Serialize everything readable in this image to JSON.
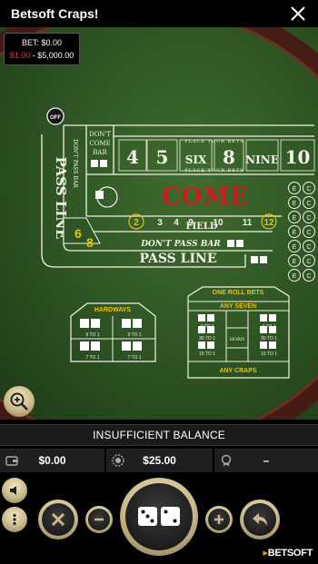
{
  "app": {
    "title": "Betsoft Craps!"
  },
  "bet_box": {
    "bet_label": "BET: $0.00",
    "min": "$1.00",
    "range_rest": " - $5,000.00"
  },
  "table": {
    "off_puck": "OFF",
    "dont_come_bar": [
      "DON'T",
      "COME",
      "BAR"
    ],
    "place_your_bets": "PLACE YOUR BETS",
    "place_numbers": [
      "4",
      "5",
      "SIX",
      "8",
      "NINE",
      "10"
    ],
    "come": "COME",
    "field_numbers": [
      "2",
      "3",
      "4",
      "9",
      "10",
      "11",
      "12"
    ],
    "field": "FIELD",
    "dont_pass_bar": "DON'T PASS BAR",
    "pass_line": "PASS LINE",
    "dont_pass_bar_vertical": "DON'T PASS BAR",
    "big_six": "6",
    "big_eight": "8",
    "hardways": "HARDWAYS",
    "hardways_odds": [
      "9 TO 1",
      "9 TO 1",
      "7 TO 1",
      "7 TO 1"
    ],
    "one_roll_bets": "ONE ROLL BETS",
    "any_seven": "ANY SEVEN",
    "any_craps": "ANY CRAPS",
    "horn": "HORN",
    "prop_odds": [
      "4 TO 1",
      "4 TO 1",
      "30 TO 1",
      "30 TO 1",
      "15 TO 1",
      "15 TO 1",
      "7 TO 1",
      "7 TO 1"
    ],
    "e_c_circles": 7
  },
  "status": {
    "message": "INSUFFICIENT BALANCE"
  },
  "info": {
    "balance": "$0.00",
    "chip_value": "$25.00",
    "win": "–"
  },
  "brand": {
    "bet": "BET",
    "soft": "SOFT"
  },
  "colors": {
    "felt": "#2f5524",
    "rail": "#4a1414",
    "come_red": "#c81e1e",
    "gold": "#e8c400",
    "ring": "#c9b98a"
  }
}
